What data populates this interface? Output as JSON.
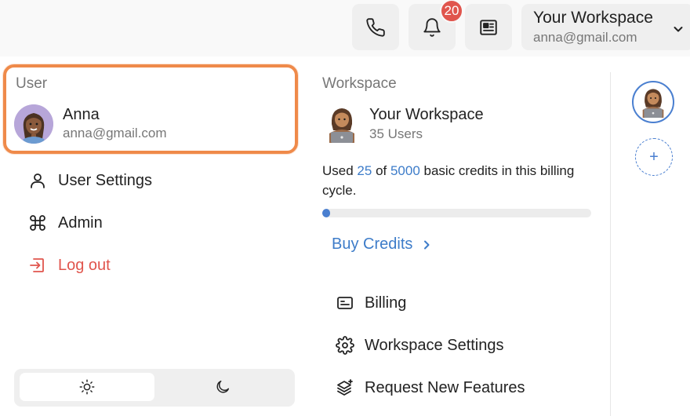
{
  "header": {
    "notification_count": "20",
    "workspace_name": "Your Workspace",
    "workspace_email": "anna@gmail.com",
    "icons": [
      "phone-icon",
      "bell-icon",
      "newspaper-icon",
      "chevron-down-icon"
    ]
  },
  "user_section": {
    "label": "User",
    "name": "Anna",
    "email": "anna@gmail.com",
    "menu": [
      {
        "label": "User Settings",
        "icon": "user-icon"
      },
      {
        "label": "Admin",
        "icon": "command-icon"
      },
      {
        "label": "Log out",
        "icon": "logout-icon"
      }
    ],
    "theme": {
      "options": [
        "sun-icon",
        "moon-icon"
      ],
      "selected": "light"
    }
  },
  "workspace_section": {
    "label": "Workspace",
    "name": "Your Workspace",
    "users": "35 Users",
    "credits": {
      "prefix": "Used ",
      "used": "25",
      "mid": " of ",
      "total": "5000",
      "suffix": " basic credits in this billing cycle.",
      "progress_fraction": 0.005
    },
    "buy_credits_label": "Buy Credits",
    "menu": [
      {
        "label": "Billing",
        "icon": "billing-icon"
      },
      {
        "label": "Workspace Settings",
        "icon": "gear-icon"
      },
      {
        "label": "Request New Features",
        "icon": "layers-sparkle-icon"
      }
    ]
  },
  "rail": {
    "add_label": "+"
  },
  "colors": {
    "accent": "#3d7cc9",
    "danger": "#e0554d",
    "highlight": "#ef8a4a"
  }
}
